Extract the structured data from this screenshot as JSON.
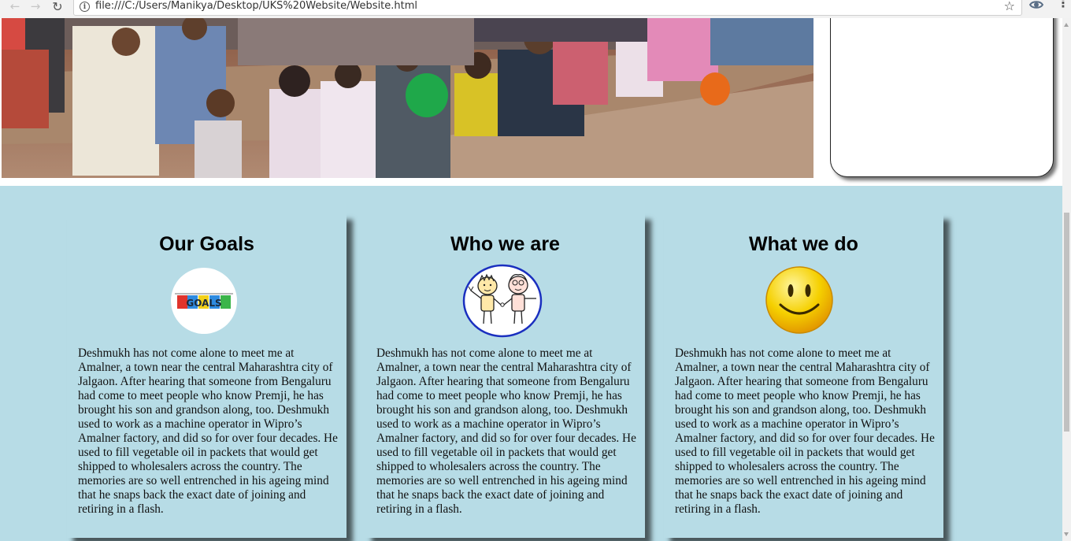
{
  "browser": {
    "url": "file:///C:/Users/Manikya/Desktop/UKS%20Website/Website.html",
    "icons": {
      "back": "back-arrow-icon",
      "forward": "forward-arrow-icon",
      "reload": "reload-icon",
      "info": "info-icon",
      "bookmark": "star-icon",
      "extension": "eye-extension-icon",
      "menu": "kebab-menu-icon"
    }
  },
  "theme": {
    "band_color": "#b7dce6"
  },
  "cards": [
    {
      "title": "Our Goals",
      "icon": "goals-icon",
      "icon_text": "GOALS",
      "text": "Deshmukh has not come alone to meet me at Amalner, a town near the central Maharashtra city of Jalgaon. After hearing that someone from Bengaluru had come to meet people who know Premji, he has brought his son and grandson along, too. Deshmukh used to work as a machine operator in Wipro’s Amalner factory, and did so for over four decades. He used to fill vegetable oil in packets that would get shipped to wholesalers across the country. The memories are so well entrenched in his ageing mind that he snaps back the exact date of joining and retiring in a flash."
    },
    {
      "title": "Who we are",
      "icon": "two-kids-icon",
      "text": "Deshmukh has not come alone to meet me at Amalner, a town near the central Maharashtra city of Jalgaon. After hearing that someone from Bengaluru had come to meet people who know Premji, he has brought his son and grandson along, too. Deshmukh used to work as a machine operator in Wipro’s Amalner factory, and did so for over four decades. He used to fill vegetable oil in packets that would get shipped to wholesalers across the country. The memories are so well entrenched in his ageing mind that he snaps back the exact date of joining and retiring in a flash."
    },
    {
      "title": "What we do",
      "icon": "smiley-icon",
      "text": "Deshmukh has not come alone to meet me at Amalner, a town near the central Maharashtra city of Jalgaon. After hearing that someone from Bengaluru had come to meet people who know Premji, he has brought his son and grandson along, too. Deshmukh used to work as a machine operator in Wipro’s Amalner factory, and did so for over four decades. He used to fill vegetable oil in packets that would get shipped to wholesalers across the country. The memories are so well entrenched in his ageing mind that he snaps back the exact date of joining and retiring in a flash."
    }
  ]
}
